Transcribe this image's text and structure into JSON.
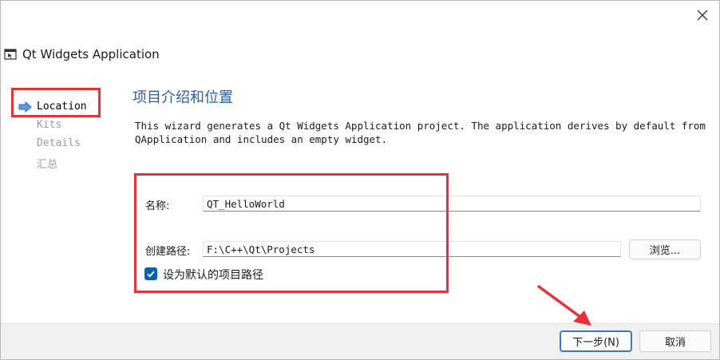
{
  "window": {
    "title": "Qt Widgets Application",
    "close_icon": "close-icon"
  },
  "steps": [
    {
      "label": "Location",
      "active": true
    },
    {
      "label": "Kits",
      "active": false
    },
    {
      "label": "Details",
      "active": false
    },
    {
      "label": "汇总",
      "active": false
    }
  ],
  "page": {
    "title": "项目介绍和位置",
    "description": "This wizard generates a Qt Widgets Application project. The application derives by default from QApplication and includes an empty widget."
  },
  "form": {
    "name_label": "名称:",
    "name_value": "QT_HelloWorld",
    "path_label": "创建路径:",
    "path_value": "F:\\C++\\Qt\\Projects",
    "browse_label": "浏览...",
    "default_checkbox_label": "设为默认的项目路径",
    "default_checked": true
  },
  "footer": {
    "next_label": "下一步(N)",
    "cancel_label": "取消"
  },
  "colors": {
    "accent": "#2f5fa0",
    "annotation": "#e8303a",
    "checkbox": "#0a5fb4"
  }
}
